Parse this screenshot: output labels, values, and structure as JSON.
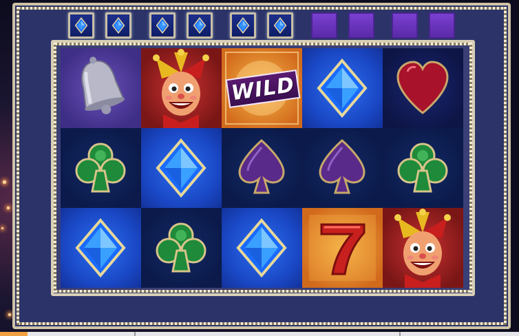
{
  "game": {
    "wild_text": "WILD"
  },
  "colors": {
    "lit_tracker": "#1d2f8c",
    "unlit_tracker": "#7a3fd0",
    "frame": "#2c3369",
    "border": "#d8cfb6"
  },
  "bonus_tracker": [
    "lit",
    "lit",
    "lit",
    "lit",
    "lit",
    "lit",
    "unlit",
    "unlit",
    "unlit",
    "unlit"
  ],
  "grid": [
    [
      "bell",
      "jester",
      "wild",
      "diamond",
      "heart"
    ],
    [
      "club",
      "diamond",
      "spade",
      "spade",
      "club"
    ],
    [
      "diamond",
      "club",
      "diamond",
      "seven",
      "jester"
    ]
  ]
}
